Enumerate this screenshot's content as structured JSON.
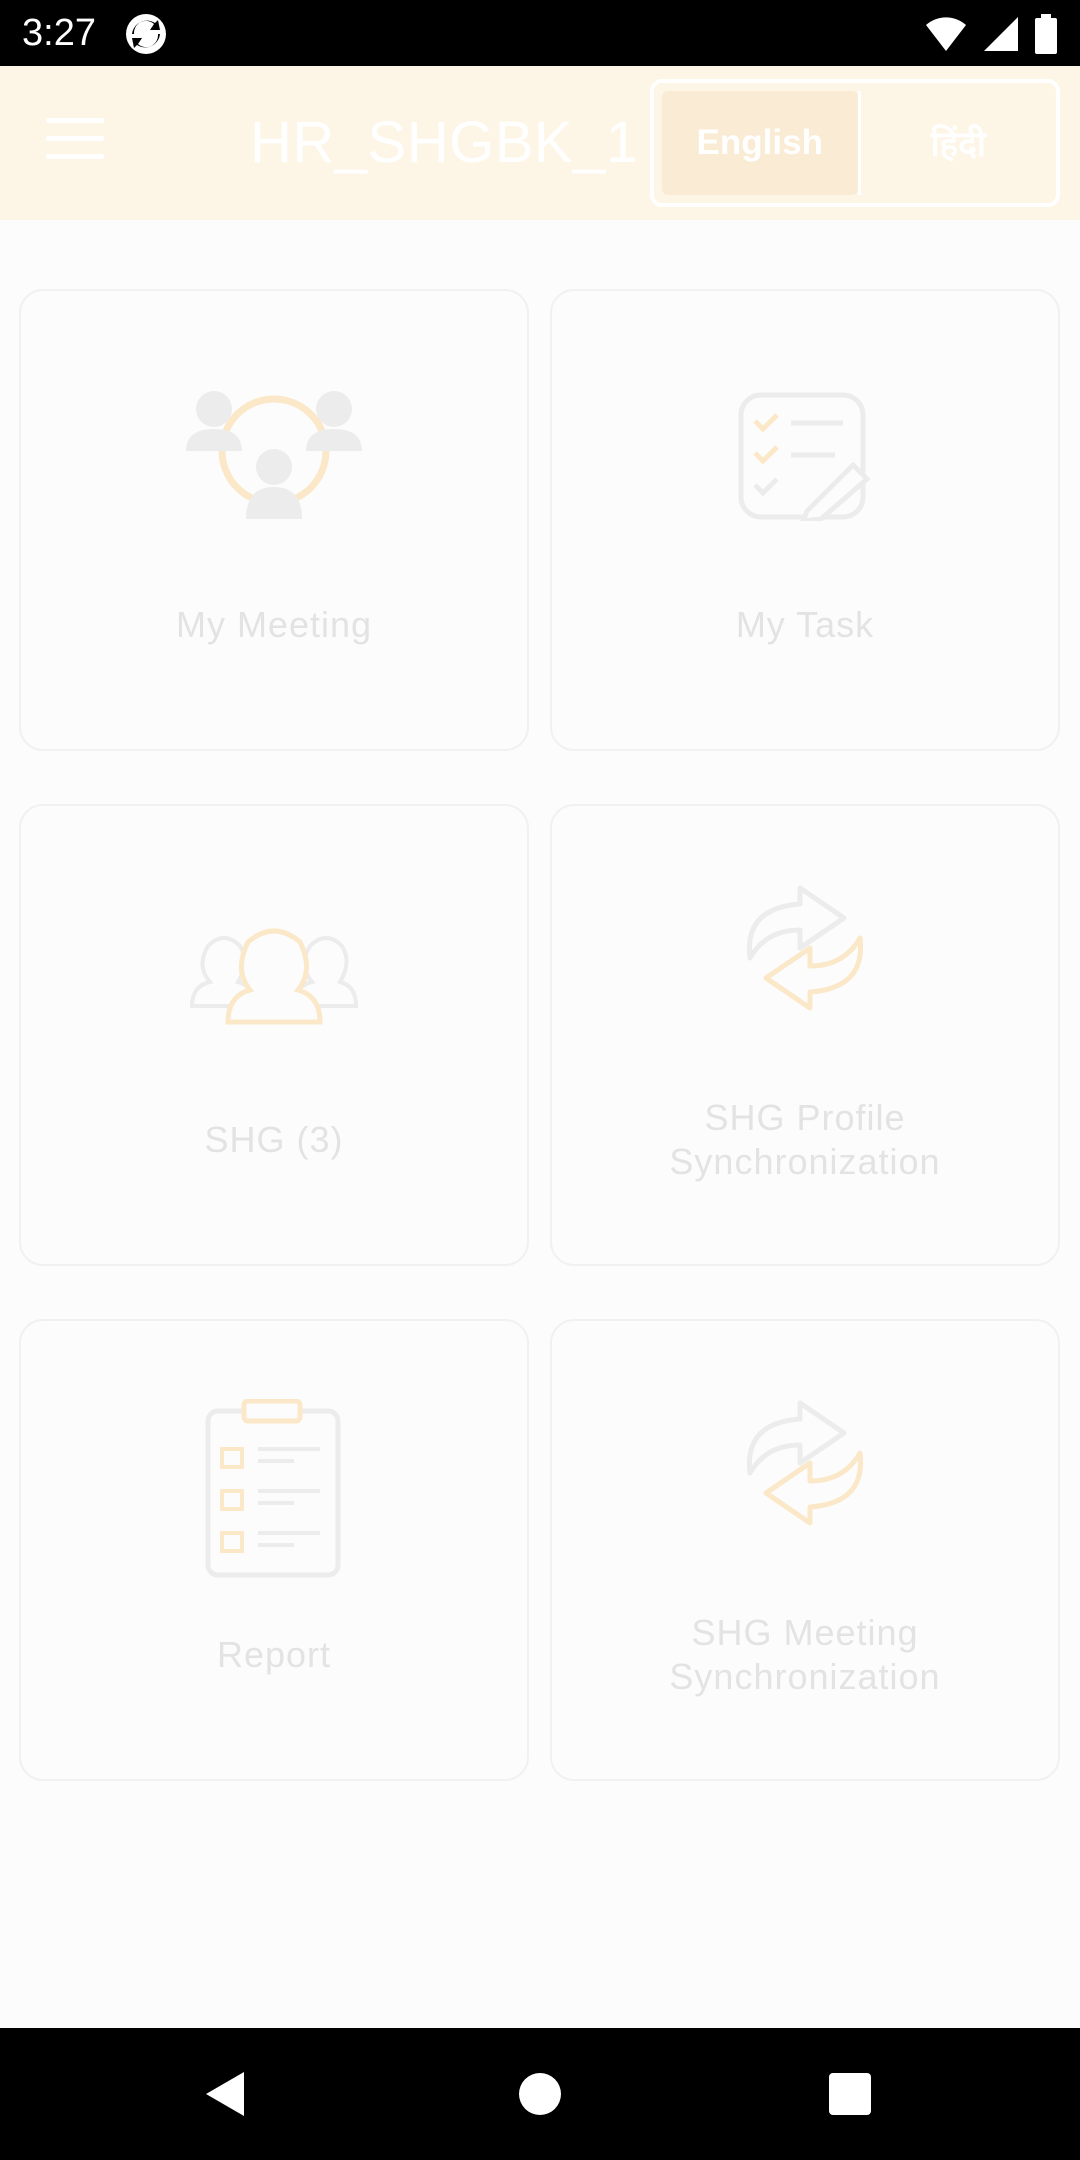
{
  "status_bar": {
    "time": "3:27",
    "icons": [
      "app-notification-icon",
      "wifi-icon",
      "signal-icon",
      "battery-icon"
    ]
  },
  "app_bar": {
    "title": "HR_SHGBK_1",
    "menu_icon": "hamburger-menu-icon",
    "languages": [
      {
        "label": "English",
        "active": true
      },
      {
        "label": "हिंदी",
        "active": false
      }
    ]
  },
  "grid": {
    "cards": [
      {
        "label": "My Meeting",
        "icon": "meeting-group-icon"
      },
      {
        "label": "My Task",
        "icon": "task-checklist-icon"
      },
      {
        "label": "SHG (3)",
        "icon": "shg-group-icon"
      },
      {
        "label": "SHG Profile Synchronization",
        "icon": "sync-icon"
      },
      {
        "label": "Report",
        "icon": "report-clipboard-icon"
      },
      {
        "label": "SHG Meeting Synchronization",
        "icon": "sync-icon"
      }
    ]
  },
  "nav_bar": {
    "buttons": [
      "back-icon",
      "home-icon",
      "recents-icon"
    ]
  },
  "colors": {
    "app_bar_bg": "#fdf6e7",
    "accent_faded": "#fbe8c8",
    "card_border": "#f1f1f1",
    "label_text": "#e3e3e3"
  }
}
